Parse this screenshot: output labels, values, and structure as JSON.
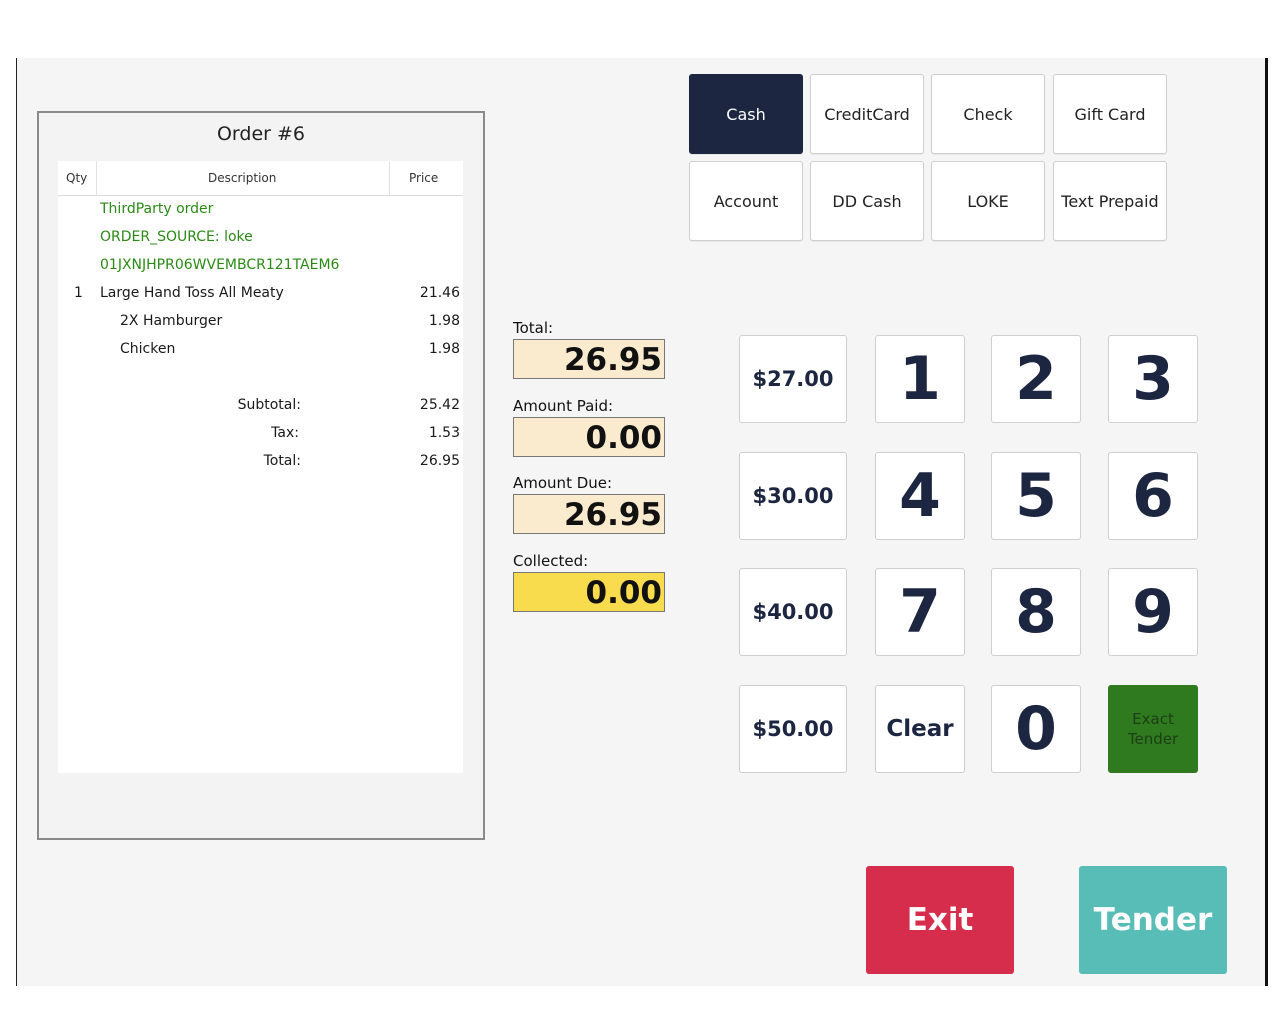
{
  "ticket": {
    "title": "Order #6",
    "columns": {
      "qty": "Qty",
      "description": "Description",
      "price": "Price"
    },
    "notes": [
      "ThirdParty order",
      "ORDER_SOURCE: loke",
      "01JXNJHPR06WVEMBCR121TAEM6"
    ],
    "items": [
      {
        "qty": "1",
        "description": "Large Hand Toss All Meaty",
        "price": "21.46"
      },
      {
        "qty": "",
        "description": "2X Hamburger",
        "price": "1.98"
      },
      {
        "qty": "",
        "description": "Chicken",
        "price": "1.98"
      }
    ],
    "totals": [
      {
        "label": "Subtotal:",
        "value": "25.42"
      },
      {
        "label": "Tax:",
        "value": "1.53"
      },
      {
        "label": "Total:",
        "value": "26.95"
      }
    ]
  },
  "payment_methods": [
    {
      "label": "Cash",
      "active": true
    },
    {
      "label": "CreditCard",
      "active": false
    },
    {
      "label": "Check",
      "active": false
    },
    {
      "label": "Gift Card",
      "active": false
    },
    {
      "label": "Account",
      "active": false
    },
    {
      "label": "DD Cash",
      "active": false
    },
    {
      "label": "LOKE",
      "active": false
    },
    {
      "label": "Text Prepaid",
      "active": false
    }
  ],
  "amounts": {
    "total_label": "Total:",
    "total": "26.95",
    "paid_label": "Amount Paid:",
    "paid": "0.00",
    "due_label": "Amount Due:",
    "due": "26.95",
    "collected_label": "Collected:",
    "collected": "0.00"
  },
  "keypad": {
    "presets": [
      "$27.00",
      "$30.00",
      "$40.00",
      "$50.00"
    ],
    "digits": [
      "1",
      "2",
      "3",
      "4",
      "5",
      "6",
      "7",
      "8",
      "9",
      "0"
    ],
    "clear": "Clear",
    "exact_tender": [
      "Exact",
      "Tender"
    ]
  },
  "actions": {
    "exit": "Exit",
    "tender": "Tender"
  },
  "colors": {
    "active_method": "#1c2641",
    "field_bg": "#faebcf",
    "collected_bg": "#f8dc4d",
    "exact_tender": "#2f7a1e",
    "exit": "#d62d4c",
    "tender": "#58bdb6",
    "note_text": "#2b8a16"
  }
}
